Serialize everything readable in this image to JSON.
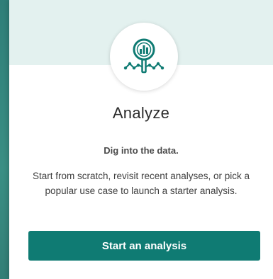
{
  "card": {
    "icon": "analyze-magnifier-chart-icon",
    "title": "Analyze",
    "subtitle": "Dig into the data.",
    "description": "Start from scratch, revisit recent analyses, or pick a popular use case to launch a starter analysis.",
    "button_label": "Start an analysis"
  },
  "colors": {
    "accent": "#0f7b73",
    "header_background": "#e3f1ef",
    "page_background": "#2f7e78"
  }
}
